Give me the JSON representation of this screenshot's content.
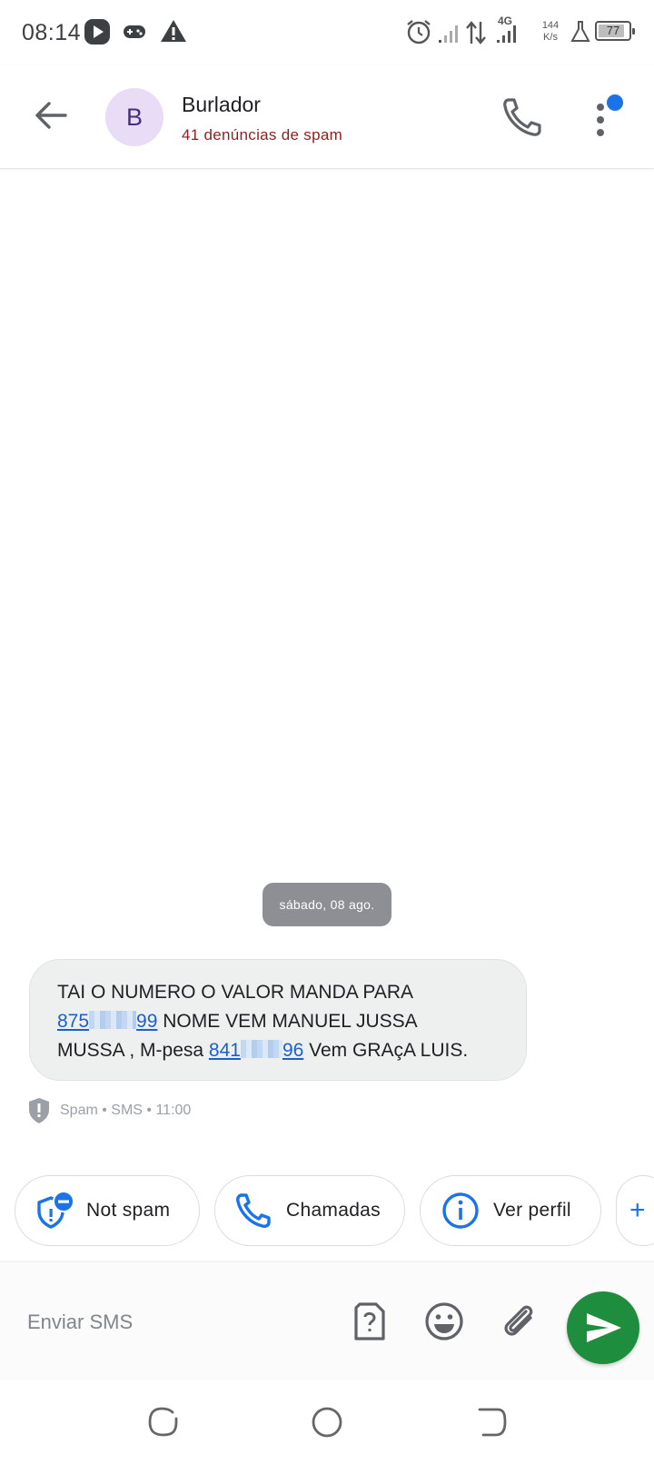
{
  "status_bar": {
    "time": "08:14",
    "network": "4G",
    "speed_value": "144",
    "speed_unit": "K/s",
    "battery": "77",
    "battery_level": 0.77
  },
  "header": {
    "avatar_letter": "B",
    "contact_name": "Burlador",
    "spam_reports": "41 denúncias de spam",
    "icons": [
      "back-arrow-icon",
      "phone-icon",
      "more-vert-icon"
    ]
  },
  "conversation": {
    "date_chip": "sábado, 08 ago.",
    "message": {
      "line1": "TAI O NUMERO O VALOR MANDA PARA",
      "number1_start": "875",
      "number1_end": "99",
      "line2_rest": " NOME VEM MANUEL JUSSA",
      "line3_start": "MUSSA , M-pesa ",
      "number2_start": "841",
      "number2_end": "96",
      "line3_end": " Vem GRAçA  LUIS."
    },
    "meta": "Spam • SMS • 11:00"
  },
  "actions": [
    {
      "label": "Not spam",
      "icon": "shield-minus-icon"
    },
    {
      "label": "Chamadas",
      "icon": "phone-icon"
    },
    {
      "label": "Ver perfil",
      "icon": "info-icon"
    }
  ],
  "compose": {
    "placeholder": "Enviar SMS",
    "icons": [
      "sim-help-icon",
      "emoji-icon",
      "attach-icon",
      "send-icon"
    ]
  },
  "colors": {
    "accent_blue": "#1a73e8",
    "send_green": "#1e8e3e",
    "avatar_bg": "#e8dcf6",
    "spam_text": "#8e1f1f"
  }
}
